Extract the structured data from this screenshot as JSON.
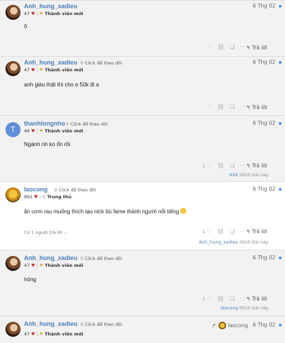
{
  "labels": {
    "click_follow": "Click để theo dõi",
    "reply": "Trả lời",
    "likes_suffix": "thích bài này"
  },
  "posts": [
    {
      "username": "Anh_hung_xadieu",
      "likes": "47",
      "title": "Thành viên mới",
      "date": "6 Thg 02",
      "content": "ô"
    },
    {
      "username": "Anh_hung_xadieu",
      "likes": "47",
      "title": "Thành viên mới",
      "date": "6 Thg 02",
      "content": "anh giàu thật thì cho e 50k đi a"
    },
    {
      "username": "thanhlongnho",
      "likes": "46",
      "title": "Thành viên mới",
      "date": "6 Thg 02",
      "content": "Ngành nh ko ổn rồi",
      "like_count": "1",
      "liker": "KhK"
    },
    {
      "username": "laocong",
      "likes": "991",
      "title": "Trung thủ",
      "date": "6 Thg 02",
      "content": "ăn cơm rau muống thích tạo nick bú fame thành người nổi tiếng",
      "like_count": "1",
      "liker": "Anh_hung_xadieu",
      "replies": "Có 1 người trả lời"
    },
    {
      "username": "Anh_hung_xadieu",
      "likes": "47",
      "title": "Thành viên mới",
      "date": "6 Thg 02",
      "content": "hóng",
      "like_count": "1",
      "liker": "laocong"
    },
    {
      "username": "Anh_hung_xadieu",
      "likes": "47",
      "title": "Thành viên mới",
      "date": "6 Thg 02",
      "reply_to": "laocong"
    }
  ]
}
